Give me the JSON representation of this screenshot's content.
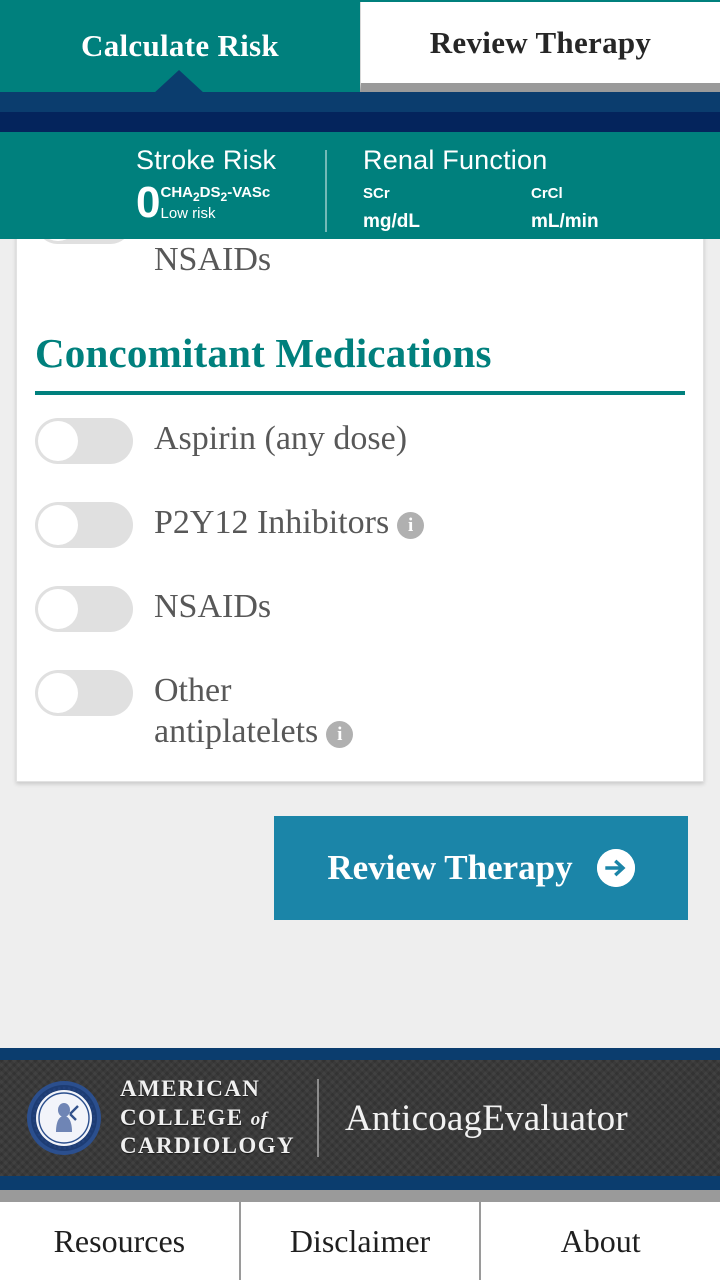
{
  "tabs": [
    {
      "label": "Calculate Risk",
      "active": true
    },
    {
      "label": "Review Therapy",
      "active": false
    }
  ],
  "summary": {
    "stroke": {
      "title": "Stroke Risk",
      "score": "0",
      "scale_prefix": "CHA",
      "scale_sub1": "2",
      "scale_mid": "DS",
      "scale_sub2": "2",
      "scale_suffix": "-VASc",
      "risk_level": "Low risk"
    },
    "renal": {
      "title": "Renal Function",
      "scr_label": "SCr",
      "scr_unit": "mg/dL",
      "crcl_label": "CrCl",
      "crcl_unit": "mL/min"
    }
  },
  "card": {
    "clipped_row": {
      "label": "Currently taking antiplatelet drugs or NSAIDs",
      "toggle_on": false
    },
    "section": {
      "title": "Concomitant Medications"
    },
    "medications": [
      {
        "label": "Aspirin (any dose)",
        "toggle_on": false,
        "has_info": false
      },
      {
        "label": "P2Y12 Inhibitors",
        "toggle_on": false,
        "has_info": true
      },
      {
        "label": "NSAIDs",
        "toggle_on": false,
        "has_info": false
      },
      {
        "label": "Other antiplatelets",
        "toggle_on": false,
        "has_info": true
      }
    ]
  },
  "primary_button": {
    "label": "Review Therapy",
    "icon": "arrow-right-circle-icon"
  },
  "footer": {
    "org_line1": "AMERICAN",
    "org_line2a": "COLLEGE",
    "org_line2b": "of",
    "org_line3": "CARDIOLOGY",
    "app_name": "AnticoagEvaluator"
  },
  "bottom_nav": [
    {
      "label": "Resources"
    },
    {
      "label": "Disclaimer"
    },
    {
      "label": "About"
    }
  ],
  "colors": {
    "teal": "#00807d",
    "navy": "#0b3d6e",
    "navy_dark": "#04245c",
    "button_blue": "#1b85a8",
    "page_bg": "#eeeeee",
    "toggle_off": "#e0e0e0",
    "label_grey": "#585858"
  }
}
